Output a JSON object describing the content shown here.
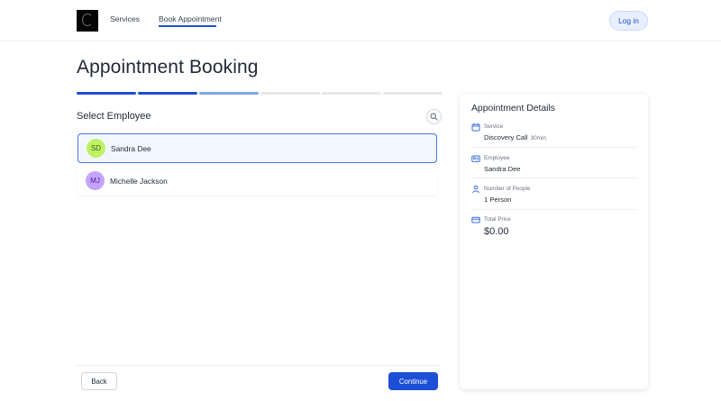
{
  "header": {
    "nav": [
      {
        "label": "Services"
      },
      {
        "label": "Book Appointment"
      }
    ],
    "login_label": "Log in"
  },
  "page": {
    "title": "Appointment Booking",
    "stepper": {
      "total_steps": 6,
      "completed_steps": 2,
      "current_step": 3,
      "colors": {
        "completed": "#1d4ed8",
        "current": "#7fa6e8",
        "pending": "#e5e7eb"
      }
    }
  },
  "employee_section": {
    "title": "Select Employee",
    "employees": [
      {
        "initials": "SD",
        "name": "Sandra Dee",
        "selected": true,
        "avatar_bg": "#bef264",
        "avatar_fg": "#3f6212"
      },
      {
        "initials": "MJ",
        "name": "Michelle Jackson",
        "selected": false,
        "avatar_bg": "#c4a4ff",
        "avatar_fg": "#4c1d95"
      }
    ]
  },
  "footer": {
    "back_label": "Back",
    "continue_label": "Continue"
  },
  "details": {
    "title": "Appointment Details",
    "service": {
      "label": "Service",
      "value": "Discovery Call",
      "duration": "30min",
      "icon": "calendar-icon"
    },
    "employee": {
      "label": "Employee",
      "value": "Sandra Dee",
      "icon": "id-card-icon"
    },
    "people": {
      "label": "Number of People",
      "value": "1 Person",
      "icon": "person-icon"
    },
    "price": {
      "label": "Total Price",
      "value": "$0.00",
      "icon": "credit-card-icon"
    }
  },
  "colors": {
    "accent": "#1d4ed8",
    "icon": "#3b6fd8"
  }
}
